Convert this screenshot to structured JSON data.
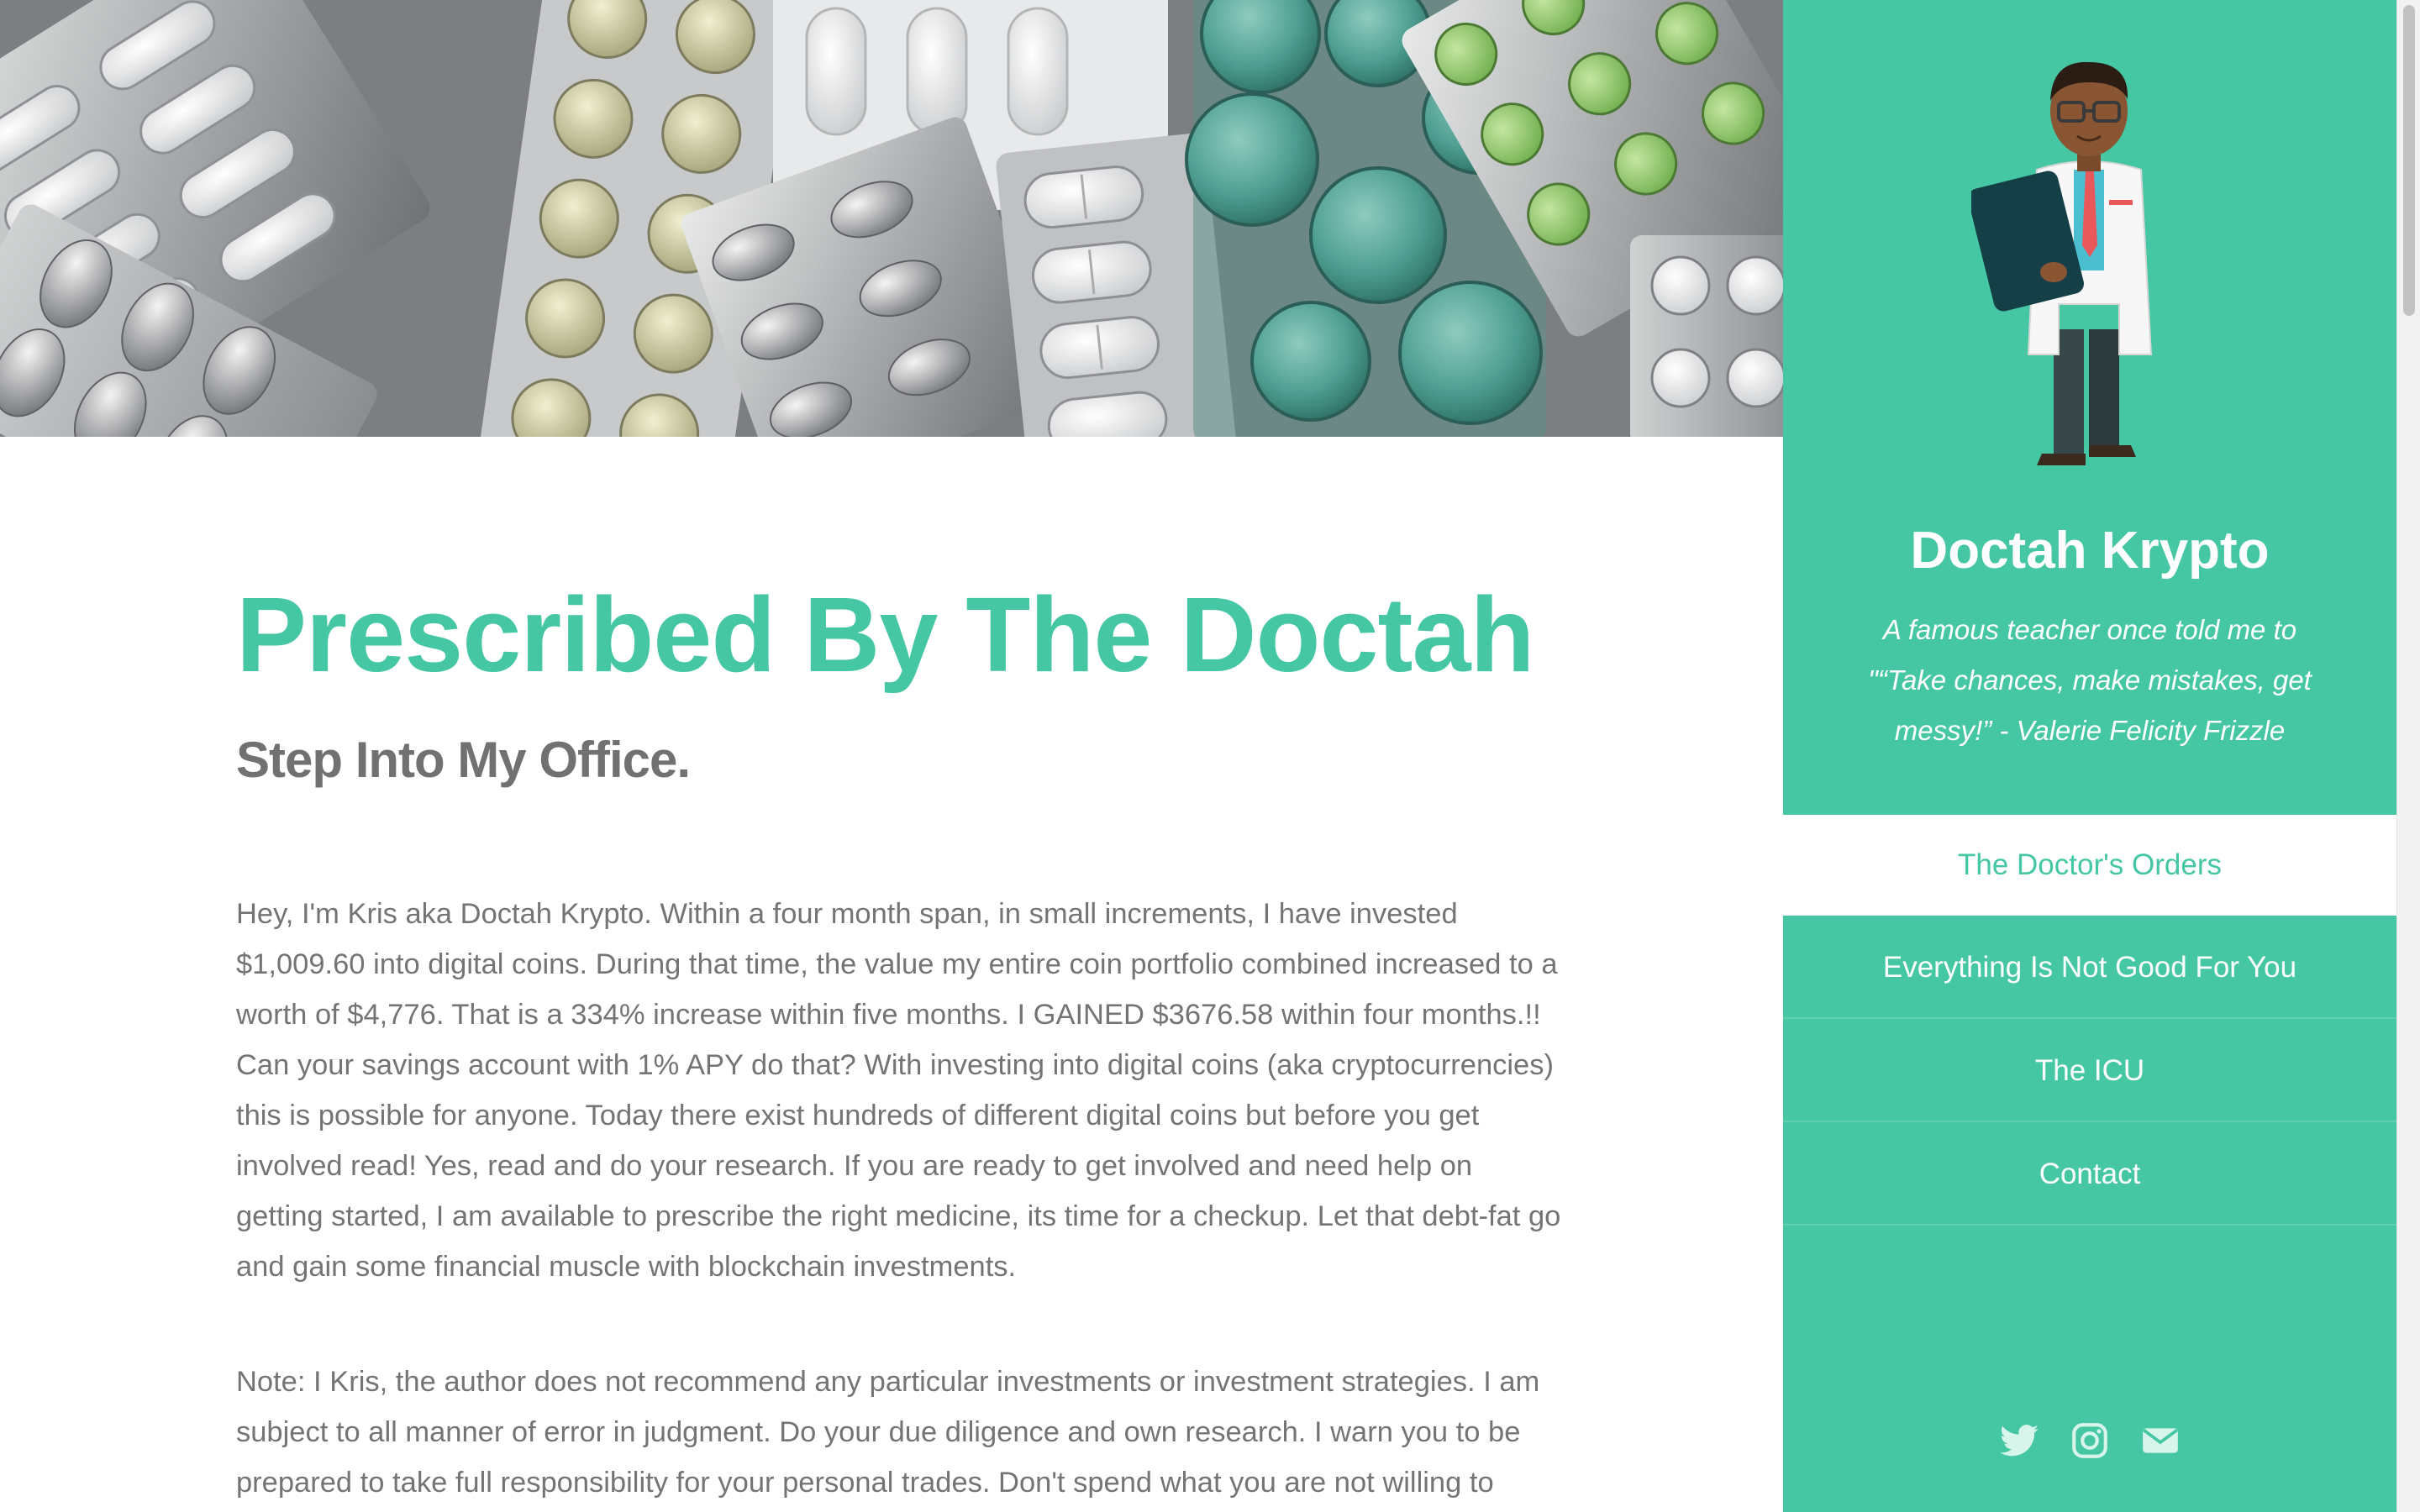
{
  "hero": {
    "image_description_icon": "pill-blister-packs-image"
  },
  "main": {
    "title": "Prescribed By The Doctah",
    "subtitle": "Step Into My Office.",
    "paragraphs": [
      "Hey, I'm Kris aka Doctah Krypto. Within a four month span, in small increments, I have invested $1,009.60 into digital coins. During that time, the value my entire coin portfolio combined increased to a worth of $4,776. That is a 334% increase within five months. I GAINED $3676.58 within four months.!! Can your savings account with 1% APY do that? With investing into digital coins (aka cryptocurrencies) this is possible for anyone. Today there exist hundreds of different digital coins but before you get involved read! Yes, read and do your research. If you are ready to get involved and need help on getting started, I am available to prescribe the right medicine, its time for a checkup. Let that debt-fat go and gain some financial muscle with blockchain investments.",
      "Note: I Kris, the author does not recommend any particular investments or investment strategies. I am subject to all manner of error in judgment. Do your due diligence and own research. I warn you to be prepared to take full responsibility for your personal trades. Don't spend what you are not willing to"
    ]
  },
  "sidebar": {
    "avatar_icon": "doctor-avatar",
    "site_title": "Doctah Krypto",
    "tagline": "A famous teacher once told me to \"“Take chances, make mistakes, get messy!” - Valerie Felicity Frizzle",
    "nav": [
      {
        "label": "The Doctor's Orders",
        "active": true
      },
      {
        "label": "Everything Is Not Good For You",
        "active": false
      },
      {
        "label": "The ICU",
        "active": false
      },
      {
        "label": "Contact",
        "active": false
      }
    ],
    "social": [
      {
        "icon": "twitter-icon"
      },
      {
        "icon": "instagram-icon"
      },
      {
        "icon": "email-icon"
      }
    ]
  },
  "colors": {
    "accent": "#46c7a3",
    "body_text": "#747474",
    "subtitle_text": "#717171",
    "white": "#ffffff"
  }
}
